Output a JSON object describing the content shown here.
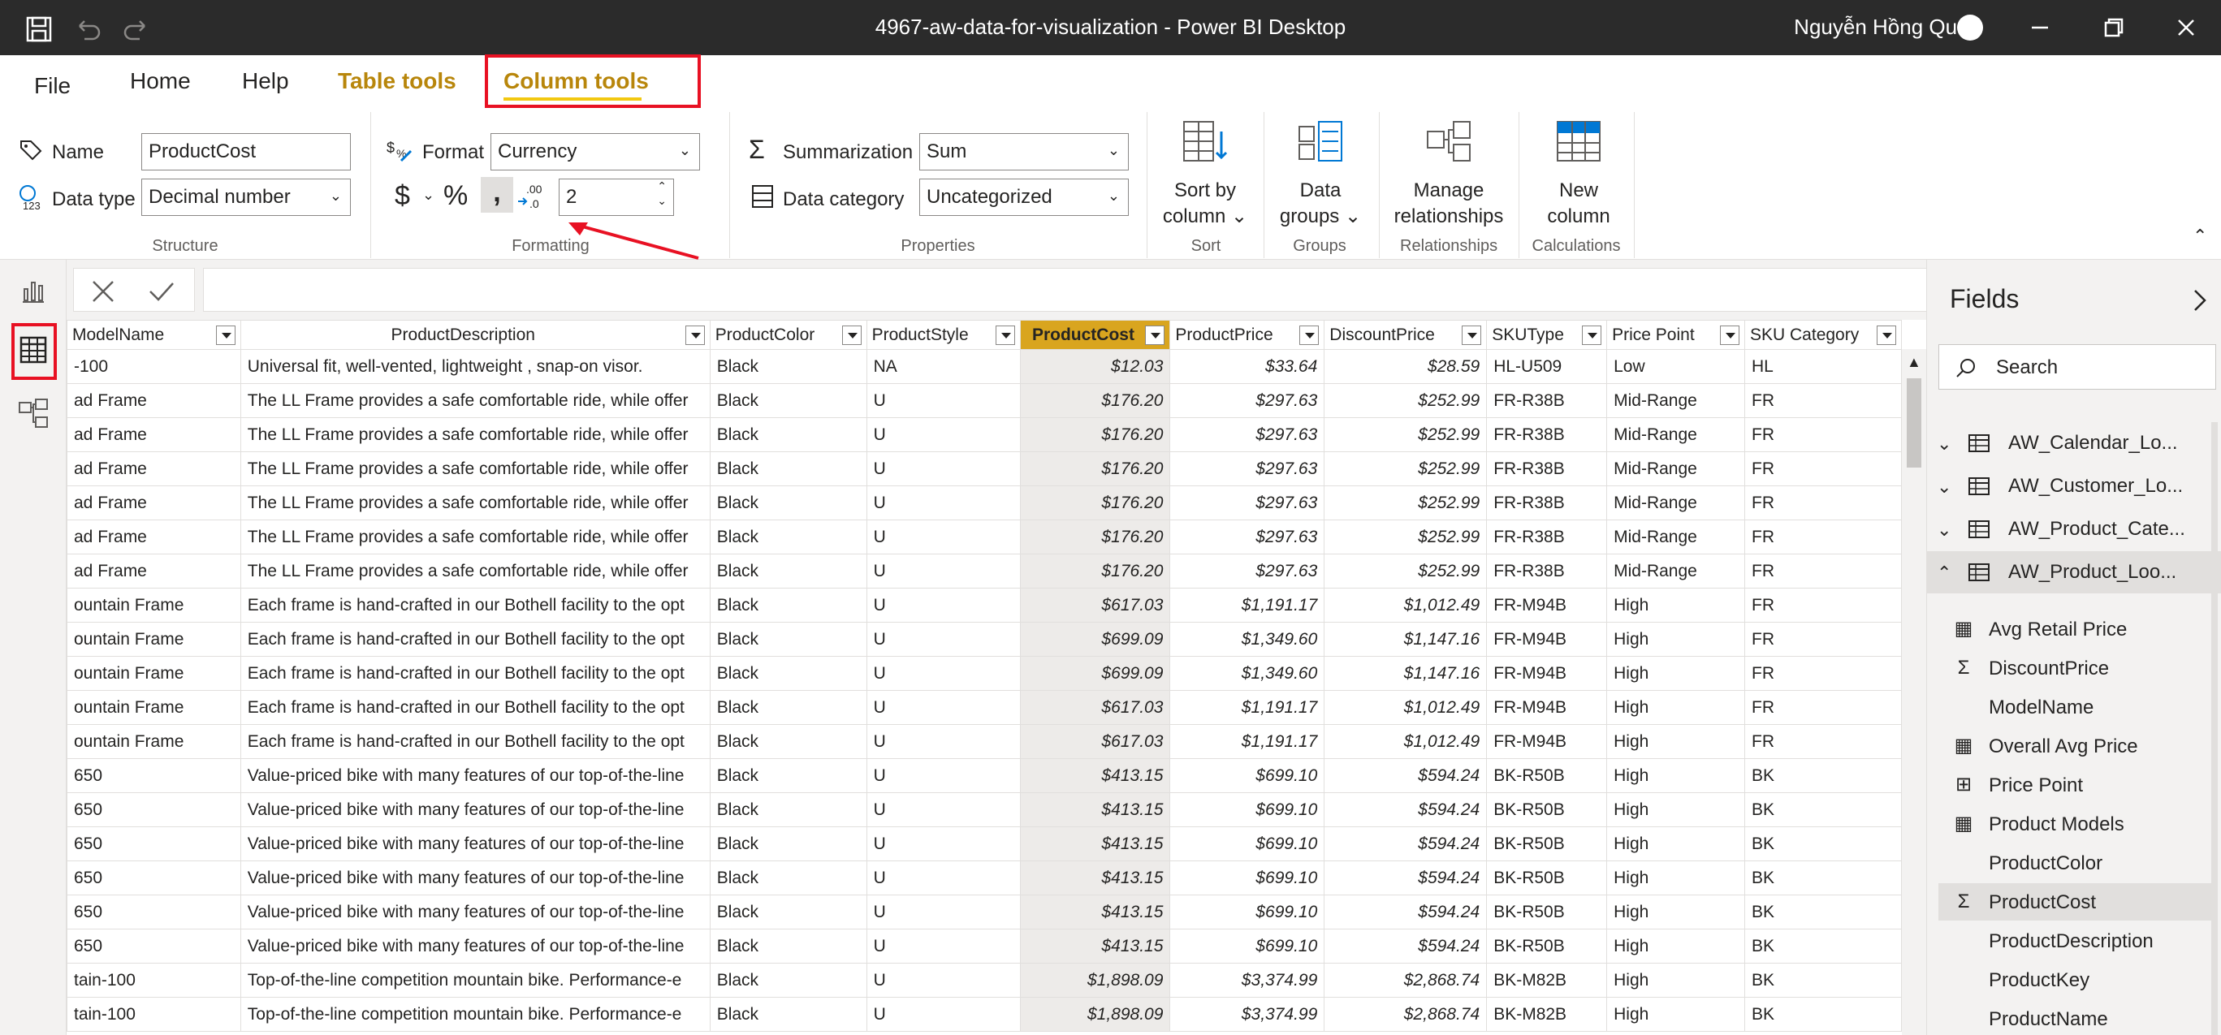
{
  "window": {
    "title": "4967-aw-data-for-visualization - Power BI Desktop",
    "user": "Nguyễn Hồng Quân",
    "icons": [
      "save-icon",
      "undo-icon",
      "redo-icon",
      "minimize-icon",
      "restore-icon",
      "close-icon"
    ]
  },
  "tabs": [
    {
      "label": "File"
    },
    {
      "label": "Home"
    },
    {
      "label": "Help"
    },
    {
      "label": "Table tools"
    },
    {
      "label": "Column tools"
    }
  ],
  "ribbon": {
    "structure": {
      "name_label": "Name",
      "name_value": "ProductCost",
      "datatype_label": "Data type",
      "datatype_value": "Decimal number",
      "group_label": "Structure"
    },
    "formatting": {
      "format_label": "Format",
      "format_value": "Currency",
      "currency_symbol": "$",
      "percent_symbol": "%",
      "decimals_value": "2",
      "group_label": "Formatting"
    },
    "properties": {
      "summarization_label": "Summarization",
      "summarization_value": "Sum",
      "category_label": "Data category",
      "category_value": "Uncategorized",
      "group_label": "Properties"
    },
    "sort": {
      "button_line1": "Sort by",
      "button_line2": "column",
      "group_label": "Sort"
    },
    "groups": {
      "button_line1": "Data",
      "button_line2": "groups",
      "group_label": "Groups"
    },
    "relationships": {
      "button_line1": "Manage",
      "button_line2": "relationships",
      "group_label": "Relationships"
    },
    "calculations": {
      "button_line1": "New",
      "button_line2": "column",
      "group_label": "Calculations"
    }
  },
  "table": {
    "columns": [
      "ModelName",
      "ProductDescription",
      "ProductColor",
      "ProductStyle",
      "ProductCost",
      "ProductPrice",
      "DiscountPrice",
      "SKUType",
      "Price Point",
      "SKU Category"
    ],
    "rows": [
      [
        "-100",
        "Universal fit, well-vented, lightweight , snap-on visor.",
        "Black",
        "NA",
        "$12.03",
        "$33.64",
        "$28.59",
        "HL-U509",
        "Low",
        "HL"
      ],
      [
        "ad Frame",
        "The LL Frame provides a safe comfortable ride, while offer",
        "Black",
        "U",
        "$176.20",
        "$297.63",
        "$252.99",
        "FR-R38B",
        "Mid-Range",
        "FR"
      ],
      [
        "ad Frame",
        "The LL Frame provides a safe comfortable ride, while offer",
        "Black",
        "U",
        "$176.20",
        "$297.63",
        "$252.99",
        "FR-R38B",
        "Mid-Range",
        "FR"
      ],
      [
        "ad Frame",
        "The LL Frame provides a safe comfortable ride, while offer",
        "Black",
        "U",
        "$176.20",
        "$297.63",
        "$252.99",
        "FR-R38B",
        "Mid-Range",
        "FR"
      ],
      [
        "ad Frame",
        "The LL Frame provides a safe comfortable ride, while offer",
        "Black",
        "U",
        "$176.20",
        "$297.63",
        "$252.99",
        "FR-R38B",
        "Mid-Range",
        "FR"
      ],
      [
        "ad Frame",
        "The LL Frame provides a safe comfortable ride, while offer",
        "Black",
        "U",
        "$176.20",
        "$297.63",
        "$252.99",
        "FR-R38B",
        "Mid-Range",
        "FR"
      ],
      [
        "ad Frame",
        "The LL Frame provides a safe comfortable ride, while offer",
        "Black",
        "U",
        "$176.20",
        "$297.63",
        "$252.99",
        "FR-R38B",
        "Mid-Range",
        "FR"
      ],
      [
        "ountain Frame",
        "Each frame is hand-crafted in our Bothell facility to the opt",
        "Black",
        "U",
        "$617.03",
        "$1,191.17",
        "$1,012.49",
        "FR-M94B",
        "High",
        "FR"
      ],
      [
        "ountain Frame",
        "Each frame is hand-crafted in our Bothell facility to the opt",
        "Black",
        "U",
        "$699.09",
        "$1,349.60",
        "$1,147.16",
        "FR-M94B",
        "High",
        "FR"
      ],
      [
        "ountain Frame",
        "Each frame is hand-crafted in our Bothell facility to the opt",
        "Black",
        "U",
        "$699.09",
        "$1,349.60",
        "$1,147.16",
        "FR-M94B",
        "High",
        "FR"
      ],
      [
        "ountain Frame",
        "Each frame is hand-crafted in our Bothell facility to the opt",
        "Black",
        "U",
        "$617.03",
        "$1,191.17",
        "$1,012.49",
        "FR-M94B",
        "High",
        "FR"
      ],
      [
        "ountain Frame",
        "Each frame is hand-crafted in our Bothell facility to the opt",
        "Black",
        "U",
        "$617.03",
        "$1,191.17",
        "$1,012.49",
        "FR-M94B",
        "High",
        "FR"
      ],
      [
        "650",
        "Value-priced bike with many features of our top-of-the-line",
        "Black",
        "U",
        "$413.15",
        "$699.10",
        "$594.24",
        "BK-R50B",
        "High",
        "BK"
      ],
      [
        "650",
        "Value-priced bike with many features of our top-of-the-line",
        "Black",
        "U",
        "$413.15",
        "$699.10",
        "$594.24",
        "BK-R50B",
        "High",
        "BK"
      ],
      [
        "650",
        "Value-priced bike with many features of our top-of-the-line",
        "Black",
        "U",
        "$413.15",
        "$699.10",
        "$594.24",
        "BK-R50B",
        "High",
        "BK"
      ],
      [
        "650",
        "Value-priced bike with many features of our top-of-the-line",
        "Black",
        "U",
        "$413.15",
        "$699.10",
        "$594.24",
        "BK-R50B",
        "High",
        "BK"
      ],
      [
        "650",
        "Value-priced bike with many features of our top-of-the-line",
        "Black",
        "U",
        "$413.15",
        "$699.10",
        "$594.24",
        "BK-R50B",
        "High",
        "BK"
      ],
      [
        "650",
        "Value-priced bike with many features of our top-of-the-line",
        "Black",
        "U",
        "$413.15",
        "$699.10",
        "$594.24",
        "BK-R50B",
        "High",
        "BK"
      ],
      [
        "tain-100",
        "Top-of-the-line competition mountain bike. Performance-e",
        "Black",
        "U",
        "$1,898.09",
        "$3,374.99",
        "$2,868.74",
        "BK-M82B",
        "High",
        "BK"
      ],
      [
        "tain-100",
        "Top-of-the-line competition mountain bike. Performance-e",
        "Black",
        "U",
        "$1,898.09",
        "$3,374.99",
        "$2,868.74",
        "BK-M82B",
        "High",
        "BK"
      ]
    ]
  },
  "fields_pane": {
    "title": "Fields",
    "search_placeholder": "Search",
    "tables": [
      {
        "name": "AW_Calendar_Lo...",
        "expanded": false
      },
      {
        "name": "AW_Customer_Lo...",
        "expanded": false
      },
      {
        "name": "AW_Product_Cate...",
        "expanded": false
      },
      {
        "name": "AW_Product_Loo...",
        "expanded": true
      }
    ],
    "fields": [
      {
        "name": "Avg Retail Price",
        "icon": "calculator-icon"
      },
      {
        "name": "DiscountPrice",
        "icon": "sigma-icon"
      },
      {
        "name": "ModelName",
        "icon": ""
      },
      {
        "name": "Overall Avg Price",
        "icon": "calculator-icon"
      },
      {
        "name": "Price Point",
        "icon": "calculated-column-icon"
      },
      {
        "name": "Product Models",
        "icon": "calculator-icon"
      },
      {
        "name": "ProductColor",
        "icon": ""
      },
      {
        "name": "ProductCost",
        "icon": "sigma-icon",
        "selected": true
      },
      {
        "name": "ProductDescription",
        "icon": ""
      },
      {
        "name": "ProductKey",
        "icon": ""
      },
      {
        "name": "ProductName",
        "icon": ""
      }
    ]
  },
  "colors": {
    "accent": "#f2c811",
    "selected_header": "#d9a51f",
    "highlight_box": "#e81123",
    "titlebar": "#2b2b2b"
  }
}
